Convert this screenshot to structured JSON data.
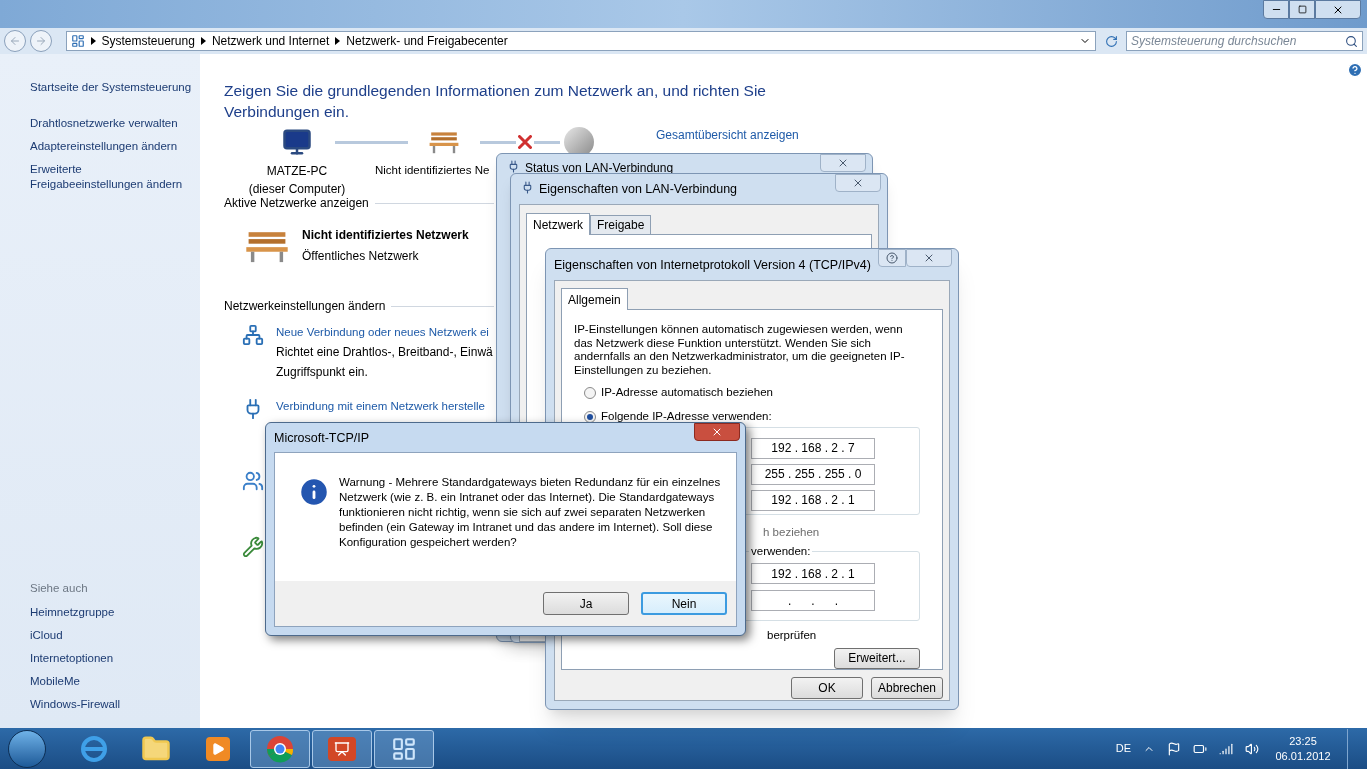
{
  "address_bar": {
    "breadcrumbs": [
      "Systemsteuerung",
      "Netzwerk und Internet",
      "Netzwerk- und Freigabecenter"
    ],
    "search": {
      "placeholder": "Systemsteuerung durchsuchen"
    }
  },
  "sidebar": {
    "items": [
      "Startseite der Systemsteuerung",
      "Drahtlosnetzwerke verwalten",
      "Adaptereinstellungen ändern",
      "Erweiterte Freigabeeinstellungen ändern"
    ],
    "see_also_title": "Siehe auch",
    "see_also": [
      "Heimnetzgruppe",
      "iCloud",
      "Internetoptionen",
      "MobileMe",
      "Windows-Firewall"
    ]
  },
  "main": {
    "heading": "Zeigen Sie die grundlegenden Informationen zum Netzwerk an, und richten Sie Verbindungen ein.",
    "map": {
      "computer": "MATZE-PC",
      "computer_sub": "(dieser Computer)",
      "network": "Nicht identifiziertes Ne",
      "link": "Gesamtübersicht anzeigen"
    },
    "active_networks": {
      "title": "Aktive Netzwerke anzeigen",
      "name": "Nicht identifiziertes Netzwerk",
      "type": "Öffentliches Netzwerk"
    },
    "settings": {
      "title": "Netzwerkeinstellungen ändern",
      "tasks": [
        {
          "kind": "new",
          "link": "Neue Verbindung oder neues Netzwerk ei",
          "lines": [
            "Richtet eine Drahtlos-, Breitband-, Einwä",
            "Zugriffspunkt ein."
          ]
        },
        {
          "kind": "connect",
          "link": "Verbindung mit einem Netzwerk herstelle"
        },
        {
          "kind": "homegroup"
        },
        {
          "kind": "troubleshoot"
        }
      ]
    }
  },
  "status_window": {
    "title": "Status von LAN-Verbindung"
  },
  "lan_properties": {
    "title": "Eigenschaften von LAN-Verbindung",
    "tabs": [
      {
        "label": "Netzwerk",
        "selected": true
      },
      {
        "label": "Freigabe",
        "selected": false
      }
    ]
  },
  "ipv4_properties": {
    "title": "Eigenschaften von Internetprotokoll Version 4 (TCP/IPv4)",
    "tabs": [
      {
        "label": "Allgemein",
        "selected": true
      }
    ],
    "description": "IP-Einstellungen können automatisch zugewiesen werden, wenn das Netzwerk diese Funktion unterstützt. Wenden Sie sich andernfalls an den Netzwerkadministrator, um die geeigneten IP-Einstellungen zu beziehen.",
    "options": [
      {
        "label": "IP-Adresse automatisch beziehen",
        "selected": false
      },
      {
        "label": "Folgende IP-Adresse verwenden:",
        "selected": true
      }
    ],
    "ip_fields": [
      "192 . 168 . 2 . 7",
      "255 . 255 . 255 . 0",
      "192 . 168 . 2 . 1"
    ],
    "dns_auto_fragment": "h beziehen",
    "dns_manual_fragment": "verwenden:",
    "dns_fields": [
      "192 . 168 . 2 . 1",
      ".      .      ."
    ],
    "validate_fragment": "berprüfen",
    "advanced_button": "Erweitert...",
    "buttons": [
      "OK",
      "Abbrechen"
    ]
  },
  "message_box": {
    "title": "Microsoft-TCP/IP",
    "text": "Warnung - Mehrere Standardgateways bieten Redundanz für ein einzelnes Netzwerk (wie z. B. ein Intranet oder das Internet). Die Standardgateways funktionieren nicht richtig, wenn sie sich auf zwei separaten Netzwerken befinden (ein Gateway im Intranet und das andere im Internet). Soll diese Konfiguration gespeichert werden?",
    "buttons": [
      {
        "label": "Ja",
        "default": false
      },
      {
        "label": "Nein",
        "default": true
      }
    ]
  },
  "taskbar": {
    "apps": [
      {
        "kind": "browser-e",
        "running": false
      },
      {
        "kind": "folder",
        "running": false
      },
      {
        "kind": "media",
        "running": false
      },
      {
        "kind": "chrome",
        "running": true
      },
      {
        "kind": "slides",
        "running": true
      },
      {
        "kind": "panel",
        "running": true
      }
    ],
    "language": "DE",
    "time": "23:25",
    "date": "06.01.2012"
  }
}
